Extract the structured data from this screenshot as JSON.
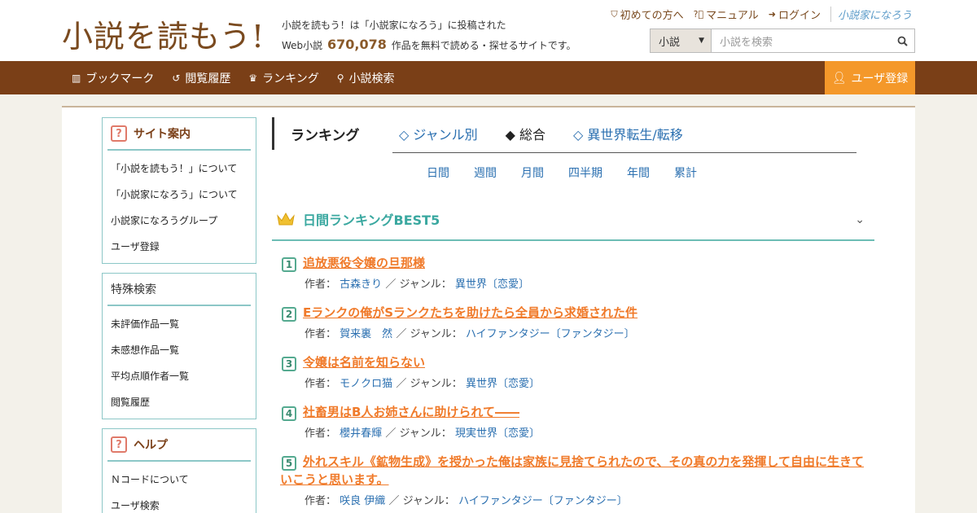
{
  "header": {
    "logo": "小説を読もう!",
    "tagline_line1": "小説を読もう！は「小説家になろう」に投稿された",
    "tagline_prefix": "Web小説",
    "work_count": "670,078",
    "tagline_suffix": "作品を無料で読める・探せるサイトです。",
    "links": [
      {
        "label": "初めての方へ",
        "icon": "shield-icon"
      },
      {
        "label": "マニュアル",
        "icon": "question-icon"
      },
      {
        "label": "ログイン",
        "icon": "login-icon"
      }
    ],
    "brand_mini": "小説家になろう",
    "search": {
      "select_value": "小説",
      "placeholder": "小説を検索"
    }
  },
  "nav": {
    "items": [
      {
        "label": "ブックマーク",
        "icon": "bookmark-icon"
      },
      {
        "label": "閲覧履歴",
        "icon": "history-icon"
      },
      {
        "label": "ランキング",
        "icon": "crown-icon"
      },
      {
        "label": "小説検索",
        "icon": "search-icon"
      }
    ],
    "register": "ユーザ登録"
  },
  "sidebar": {
    "site_guide": {
      "title": "サイト案内",
      "items": [
        "「小説を読もう！」について",
        "「小説家になろう」について",
        "小説家になろうグループ",
        "ユーザ登録"
      ]
    },
    "special_search": {
      "title": "特殊検索",
      "items": [
        "未評価作品一覧",
        "未感想作品一覧",
        "平均点順作者一覧",
        "閲覧履歴"
      ]
    },
    "help": {
      "title": "ヘルプ",
      "items": [
        "Ｎコードについて",
        "ユーザ検索"
      ]
    }
  },
  "ranking": {
    "title": "ランキング",
    "tabs": [
      "◇ ジャンル別",
      "◆ 総合",
      "◇ 異世界転生/転移"
    ],
    "periods": [
      "日間",
      "週間",
      "月間",
      "四半期",
      "年間",
      "累計"
    ],
    "best_title": "日間ランキングBEST5",
    "author_label": "作者：",
    "genre_label": "／ ジャンル：",
    "items": [
      {
        "rank": "1",
        "title": "追放悪役令嬢の旦那様",
        "author": "古森きり",
        "genre": "異世界〔恋愛〕"
      },
      {
        "rank": "2",
        "title": "Eランクの俺がSランクたちを助けたら全員から求婚された件",
        "author": "賀来裏　然",
        "genre": "ハイファンタジー〔ファンタジー〕"
      },
      {
        "rank": "3",
        "title": "令嬢は名前を知らない",
        "author": "モノクロ猫",
        "genre": "異世界〔恋愛〕"
      },
      {
        "rank": "4",
        "title": "社畜男はB人お姉さんに助けられて――",
        "author": "櫻井春輝",
        "genre": "現実世界〔恋愛〕"
      },
      {
        "rank": "5",
        "title": "外れスキル《鉱物生成》を授かった俺は家族に見捨てられたので、その真の力を発揮して自由に生きていこうと思います。",
        "author": "咲良 伊織",
        "genre": "ハイファンタジー〔ファンタジー〕"
      }
    ]
  }
}
